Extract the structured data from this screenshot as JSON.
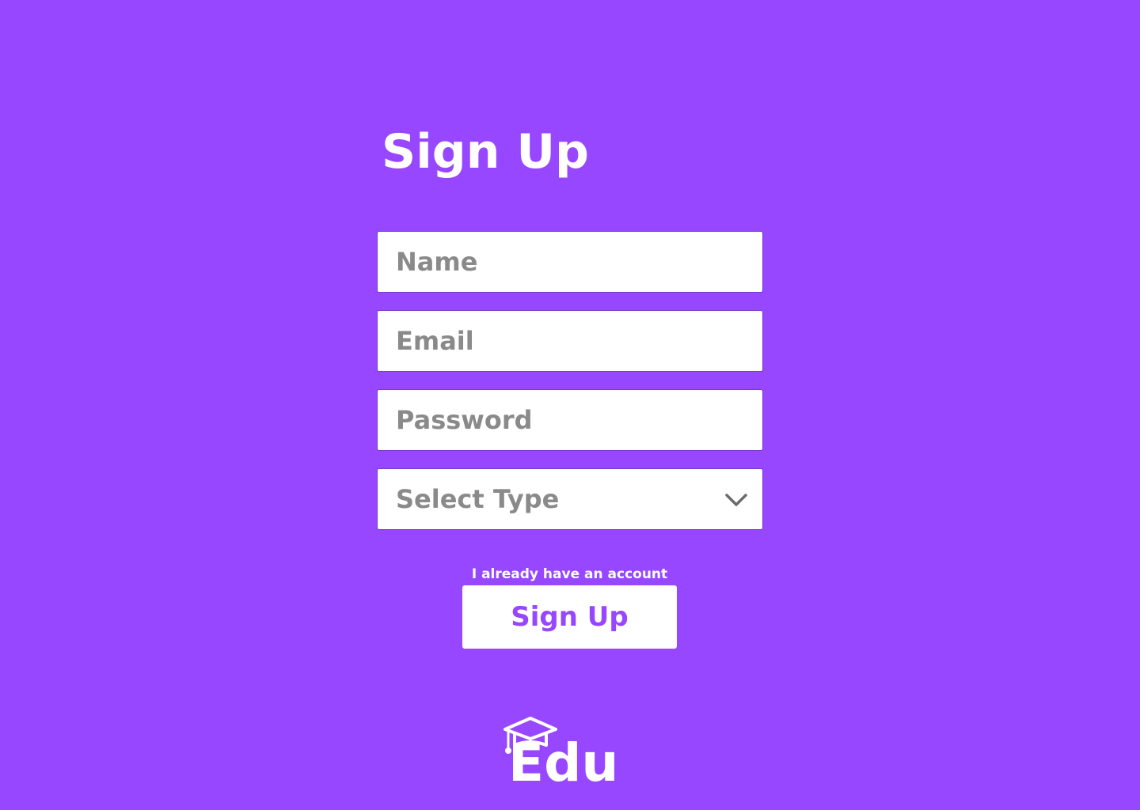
{
  "page": {
    "title": "Sign Up",
    "background_color": "#9747FF"
  },
  "form": {
    "name": {
      "placeholder": "Name",
      "value": ""
    },
    "email": {
      "placeholder": "Email",
      "value": ""
    },
    "password": {
      "placeholder": "Password",
      "value": ""
    },
    "type_select": {
      "selected": "Select Type",
      "icon": "chevron-down-icon"
    }
  },
  "signin_link": "I already have an account",
  "submit_label": "Sign Up",
  "brand": {
    "logo_text": "Edu",
    "icon": "graduation-cap-icon"
  }
}
